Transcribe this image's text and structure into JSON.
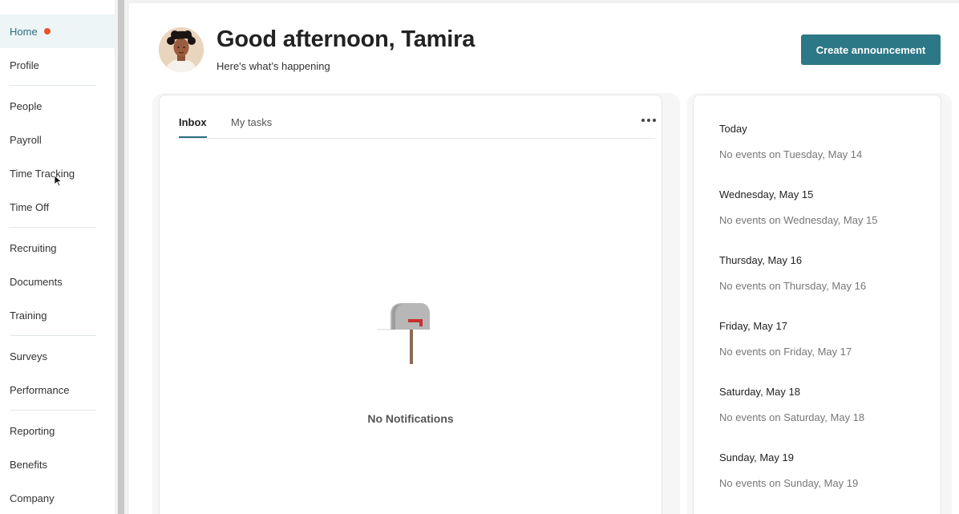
{
  "sidebar": {
    "items": [
      {
        "label": "Home",
        "active": true,
        "notification": true
      },
      {
        "label": "Profile"
      },
      {
        "label": "People"
      },
      {
        "label": "Payroll"
      },
      {
        "label": "Time Tracking"
      },
      {
        "label": "Time Off"
      },
      {
        "label": "Recruiting"
      },
      {
        "label": "Documents"
      },
      {
        "label": "Training"
      },
      {
        "label": "Surveys"
      },
      {
        "label": "Performance"
      },
      {
        "label": "Reporting"
      },
      {
        "label": "Benefits"
      },
      {
        "label": "Company"
      }
    ]
  },
  "header": {
    "greeting": "Good afternoon, Tamira",
    "subtitle": "Here's what’s happening",
    "create_button_label": "Create announcement"
  },
  "inbox": {
    "tabs": [
      {
        "label": "Inbox",
        "active": true
      },
      {
        "label": "My tasks"
      }
    ],
    "more_icon": "ellipsis-icon",
    "empty_icon": "mailbox-icon",
    "empty_message": "No Notifications"
  },
  "calendar": {
    "days": [
      {
        "title": "Today",
        "events": "No events on Tuesday, May 14"
      },
      {
        "title": "Wednesday, May 15",
        "events": "No events on Wednesday, May 15"
      },
      {
        "title": "Thursday, May 16",
        "events": "No events on Thursday, May 16"
      },
      {
        "title": "Friday, May 17",
        "events": "No events on Friday, May 17"
      },
      {
        "title": "Saturday, May 18",
        "events": "No events on Saturday, May 18"
      },
      {
        "title": "Sunday, May 19",
        "events": "No events on Sunday, May 19"
      }
    ]
  },
  "colors": {
    "accent": "#2d7886",
    "active_nav_bg": "#eef5f7",
    "notification_dot": "#e8542b"
  }
}
